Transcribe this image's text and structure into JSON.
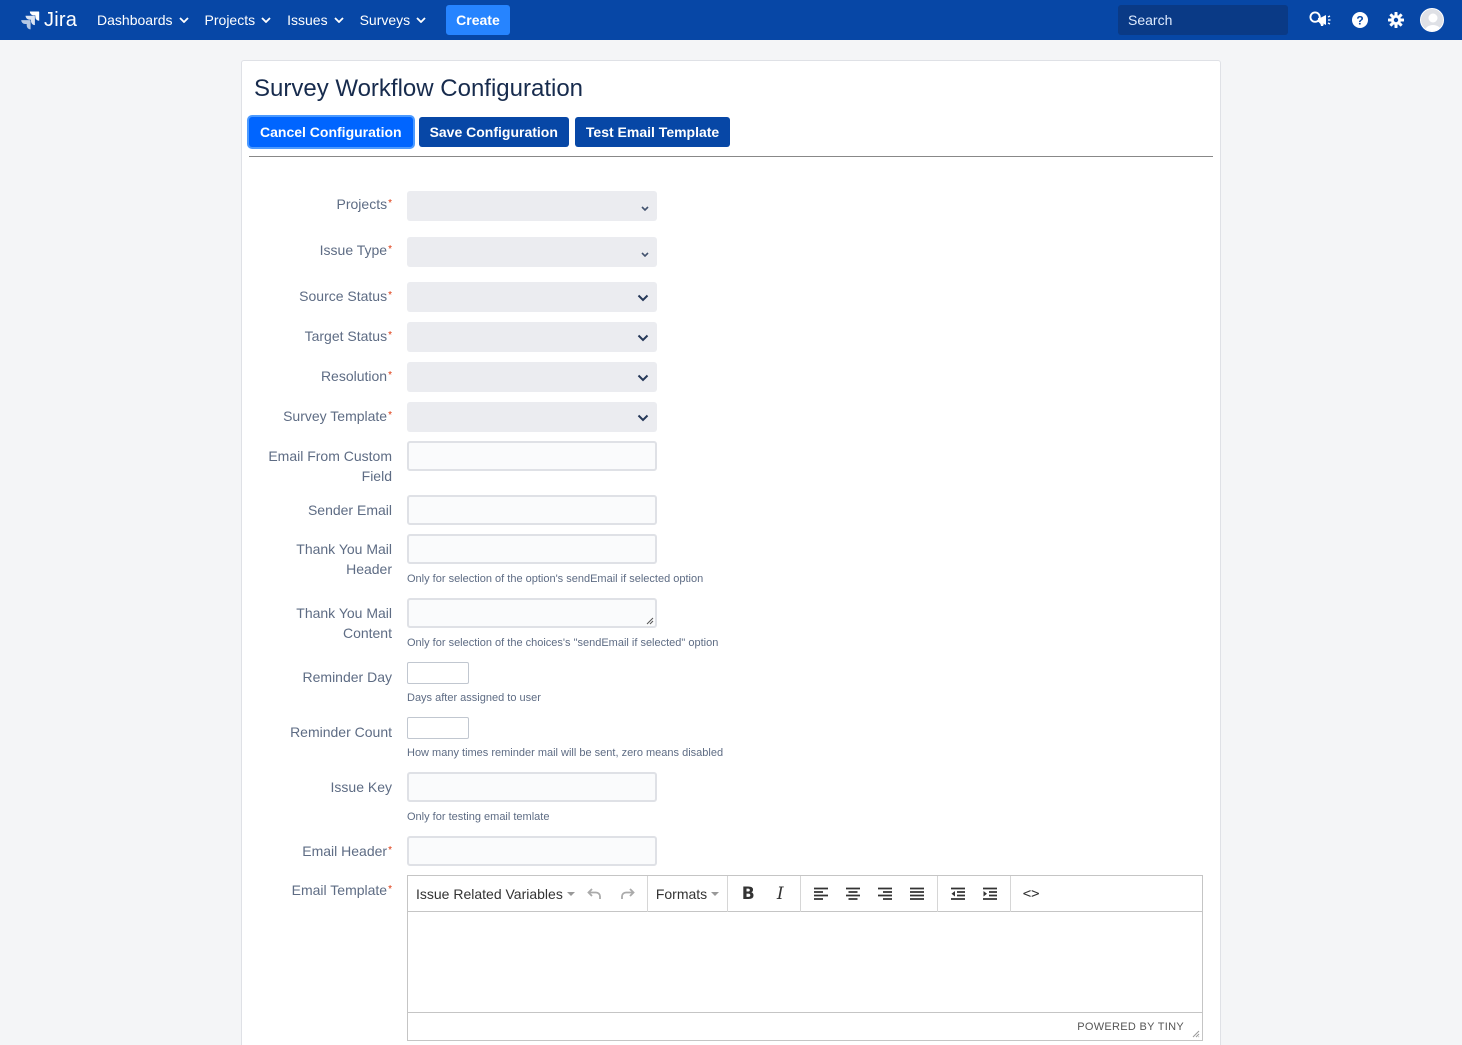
{
  "nav": {
    "logo_text": "Jira",
    "items": [
      {
        "label": "Dashboards"
      },
      {
        "label": "Projects"
      },
      {
        "label": "Issues"
      },
      {
        "label": "Surveys"
      }
    ],
    "create_label": "Create",
    "search_placeholder": "Search",
    "brand_color": "#0747a6"
  },
  "page": {
    "title": "Survey Workflow Configuration",
    "buttons": {
      "cancel": "Cancel Configuration",
      "save": "Save Configuration",
      "test": "Test Email Template"
    }
  },
  "form": {
    "projects": {
      "label": "Projects",
      "required": "*"
    },
    "issue_type": {
      "label": "Issue Type",
      "required": "*"
    },
    "source_status": {
      "label": "Source Status",
      "required": "*"
    },
    "target_status": {
      "label": "Target Status",
      "required": "*"
    },
    "resolution": {
      "label": "Resolution",
      "required": "*"
    },
    "survey_template": {
      "label": "Survey Template",
      "required": "*"
    },
    "email_from_custom_field": {
      "label_line1": "Email From Custom",
      "label_line2": "Field",
      "value": ""
    },
    "sender_email": {
      "label": "Sender Email",
      "value": ""
    },
    "thank_you_header": {
      "label_line1": "Thank You Mail",
      "label_line2": "Header",
      "value": "",
      "hint": "Only for selection of the option's sendEmail if selected option"
    },
    "thank_you_content": {
      "label_line1": "Thank You Mail",
      "label_line2": "Content",
      "value": "",
      "hint": "Only for selection of the choices's \"sendEmail if selected\" option"
    },
    "reminder_day": {
      "label": "Reminder Day",
      "value": "",
      "hint": "Days after assigned to user"
    },
    "reminder_count": {
      "label": "Reminder Count",
      "value": "",
      "hint": "How many times reminder mail will be sent, zero means disabled"
    },
    "issue_key": {
      "label": "Issue Key",
      "value": "",
      "hint": "Only for testing email temlate"
    },
    "email_header": {
      "label": "Email Header",
      "required": "*",
      "value": ""
    },
    "email_template": {
      "label": "Email Template",
      "required": "*"
    }
  },
  "editor": {
    "variables_dropdown": "Issue Related Variables",
    "formats_dropdown": "Formats",
    "bold": "B",
    "italic": "I",
    "code": "<>",
    "powered_by": "POWERED BY TINY"
  }
}
